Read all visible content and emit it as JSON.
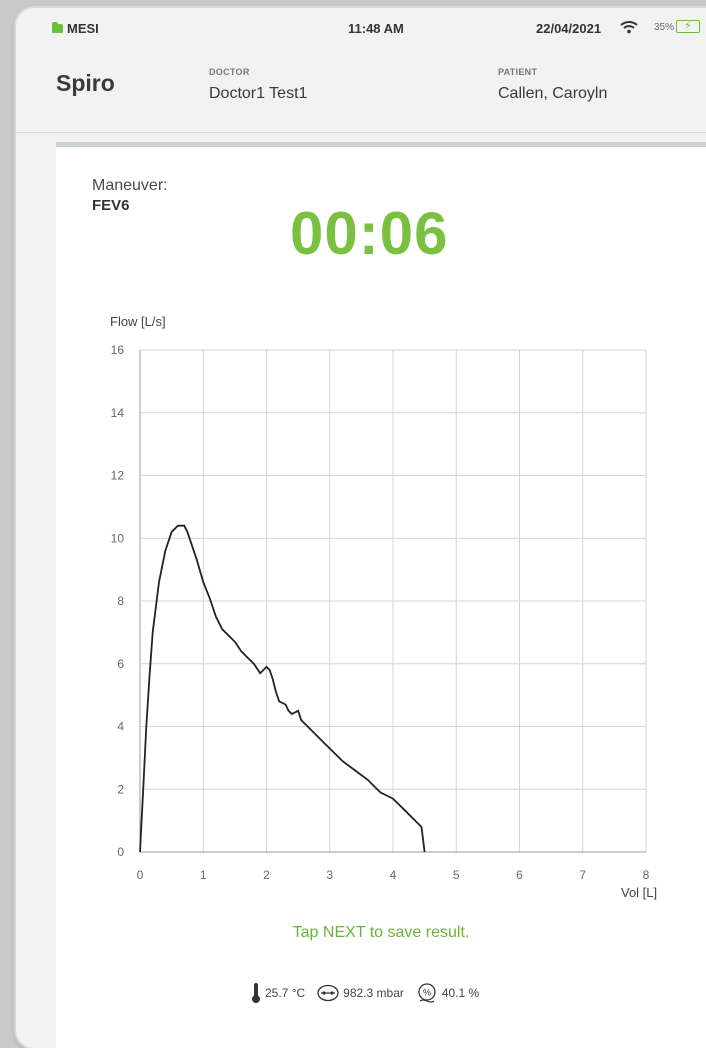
{
  "status_bar": {
    "brand": "MESI",
    "time": "11:48 AM",
    "date": "22/04/2021",
    "battery_percent": "35%",
    "wifi_icon": "wifi-icon",
    "battery_icon": "battery-charging-icon",
    "accent_color": "#6cbf3d"
  },
  "header": {
    "app_title": "Spiro",
    "doctor_label": "DOCTOR",
    "doctor_name": "Doctor1 Test1",
    "patient_label": "PATIENT",
    "patient_name": "Callen, Caroyln"
  },
  "measurement": {
    "maneuver_label": "Maneuver:",
    "maneuver_value": "FEV6",
    "timer": "00:06",
    "timer_color": "#7ac142"
  },
  "chart_data": {
    "type": "line",
    "title": "",
    "ylabel": "Flow [L/s]",
    "xlabel": "Vol [L]",
    "xlim": [
      0,
      8
    ],
    "ylim": [
      0,
      16
    ],
    "xticks": [
      0,
      1,
      2,
      3,
      4,
      5,
      6,
      7,
      8
    ],
    "yticks": [
      0,
      2,
      4,
      6,
      8,
      10,
      12,
      14,
      16
    ],
    "grid": true,
    "series": [
      {
        "name": "",
        "x": [
          0.0,
          0.05,
          0.1,
          0.15,
          0.2,
          0.3,
          0.4,
          0.5,
          0.6,
          0.7,
          0.75,
          0.8,
          0.9,
          1.0,
          1.1,
          1.2,
          1.3,
          1.4,
          1.5,
          1.6,
          1.7,
          1.8,
          1.9,
          2.0,
          2.05,
          2.1,
          2.15,
          2.2,
          2.3,
          2.35,
          2.4,
          2.5,
          2.55,
          2.6,
          2.7,
          2.8,
          2.9,
          3.0,
          3.2,
          3.4,
          3.6,
          3.7,
          3.8,
          3.9,
          4.0,
          4.1,
          4.2,
          4.3,
          4.4,
          4.45,
          4.5
        ],
        "y": [
          0.0,
          2.0,
          4.0,
          5.6,
          7.0,
          8.6,
          9.6,
          10.2,
          10.4,
          10.4,
          10.2,
          9.9,
          9.3,
          8.6,
          8.1,
          7.5,
          7.1,
          6.9,
          6.7,
          6.4,
          6.2,
          6.0,
          5.7,
          5.9,
          5.8,
          5.5,
          5.1,
          4.8,
          4.7,
          4.5,
          4.4,
          4.5,
          4.2,
          4.1,
          3.9,
          3.7,
          3.5,
          3.3,
          2.9,
          2.6,
          2.3,
          2.1,
          1.9,
          1.8,
          1.7,
          1.5,
          1.3,
          1.1,
          0.9,
          0.8,
          0.0
        ]
      }
    ]
  },
  "footer": {
    "hint": "Tap NEXT to save result.",
    "temperature": "25.7 °C",
    "pressure": "982.3 mbar",
    "humidity": "40.1 %",
    "temperature_icon": "thermometer-icon",
    "pressure_icon": "pressure-gauge-icon",
    "humidity_icon": "humidity-percent-icon"
  }
}
